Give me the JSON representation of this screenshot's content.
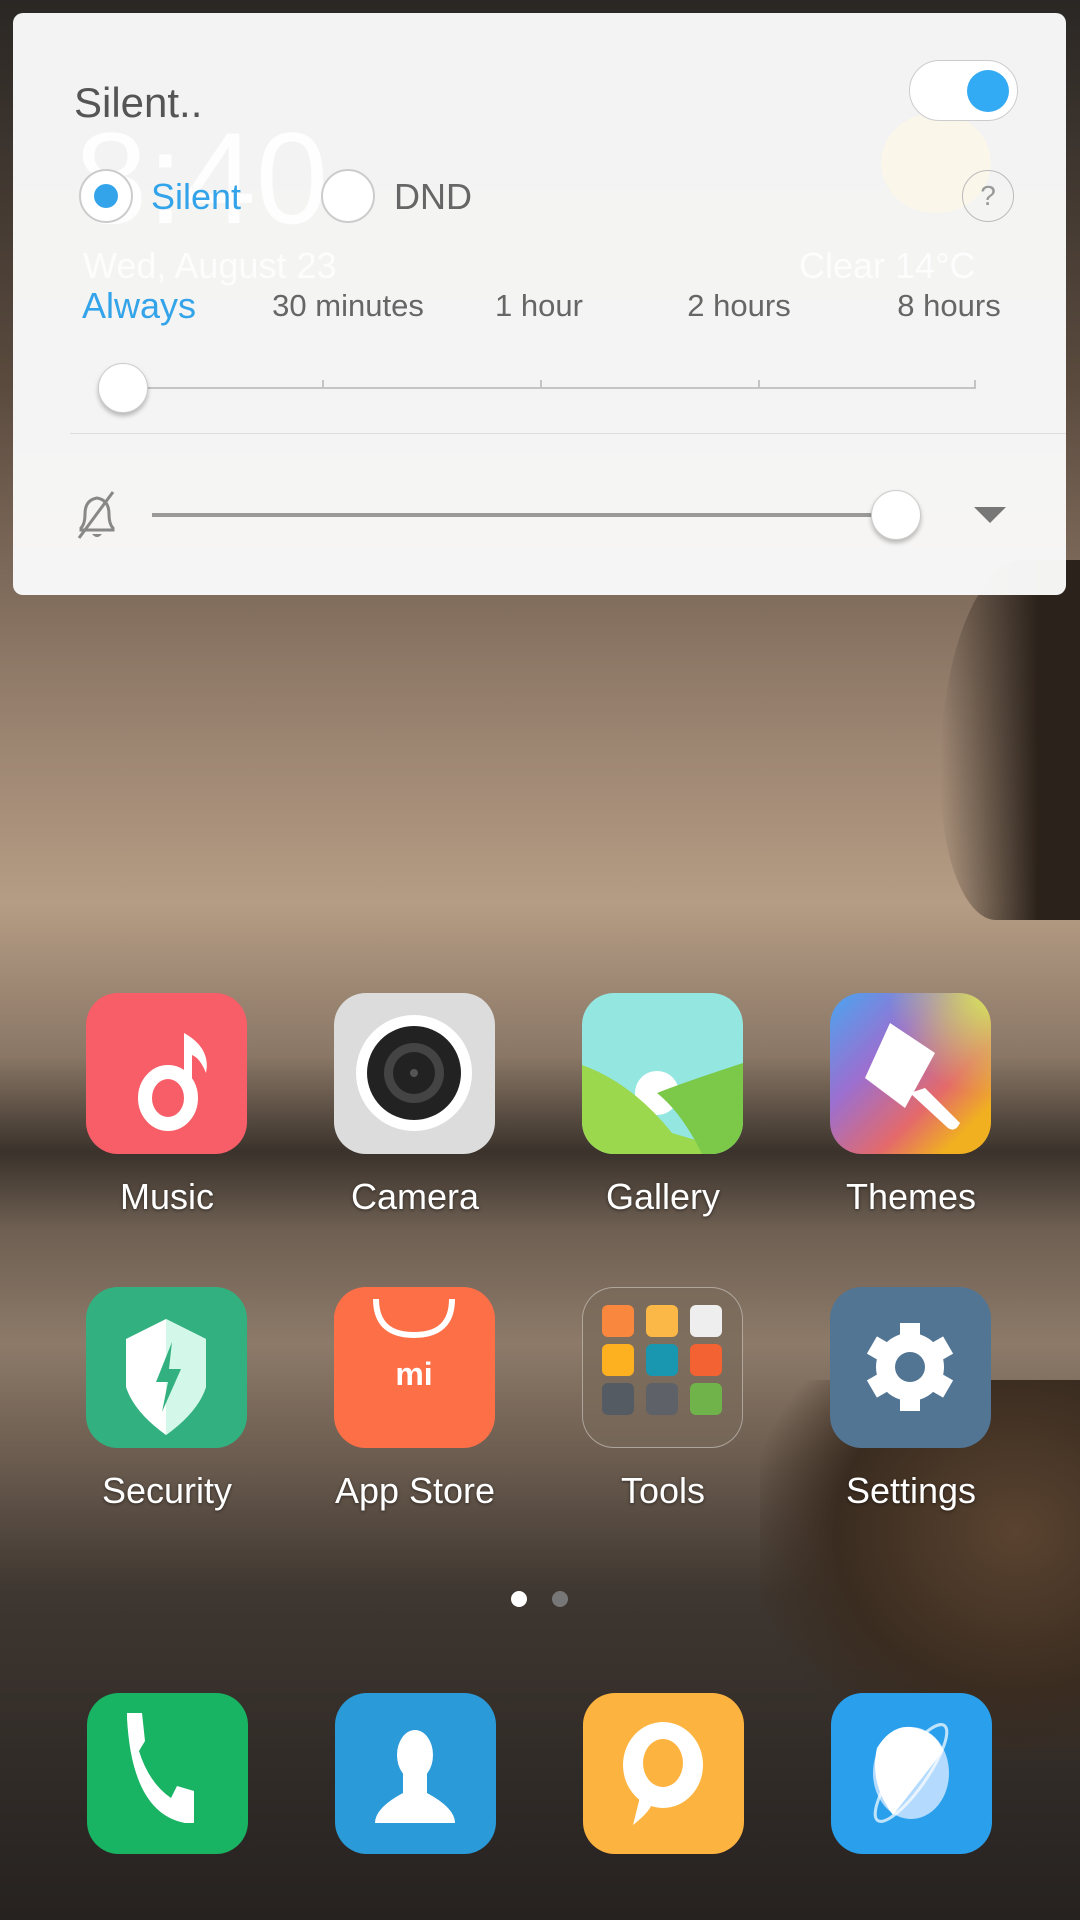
{
  "lockscreen": {
    "time": "8:40",
    "date": "Wed, August 23",
    "weather": "Clear  14°C"
  },
  "panel": {
    "title": "Silent..",
    "toggle_on": true,
    "modes": [
      {
        "label": "Silent",
        "selected": true
      },
      {
        "label": "DND",
        "selected": false
      }
    ],
    "help_label": "?",
    "durations": [
      "Always",
      "30 minutes",
      "1 hour",
      "2 hours",
      "8 hours"
    ],
    "selected_duration": "Always",
    "volume_level_percent": 100,
    "accent_color": "#33a4ea"
  },
  "home": {
    "apps": [
      {
        "label": "Music",
        "icon": "music-note-icon",
        "color": "#f75e68"
      },
      {
        "label": "Camera",
        "icon": "camera-lens-icon",
        "color": "#dcdcdc"
      },
      {
        "label": "Gallery",
        "icon": "landscape-icon",
        "color": "#94e6e1"
      },
      {
        "label": "Themes",
        "icon": "paintbrush-icon",
        "color": "#8a6fd8"
      },
      {
        "label": "Security",
        "icon": "shield-bolt-icon",
        "color": "#33b07f"
      },
      {
        "label": "App Store",
        "icon": "shopping-bag-icon",
        "color": "#fd6f47"
      },
      {
        "label": "Tools",
        "icon": "folder-icon",
        "color": "#7a6a5c"
      },
      {
        "label": "Settings",
        "icon": "gear-icon",
        "color": "#517593"
      }
    ],
    "pages": {
      "current": 1,
      "total": 2
    },
    "dock": [
      {
        "icon": "phone-icon",
        "color": "#19b364"
      },
      {
        "icon": "contacts-icon",
        "color": "#2a9ad8"
      },
      {
        "icon": "messages-icon",
        "color": "#fdb33f"
      },
      {
        "icon": "browser-icon",
        "color": "#2aa0ed"
      }
    ]
  }
}
